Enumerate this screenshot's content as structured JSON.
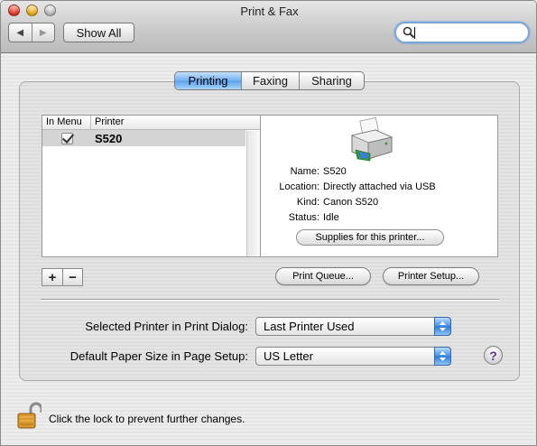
{
  "window": {
    "title": "Print & Fax"
  },
  "toolbar": {
    "back_label": "◀",
    "forward_label": "▶",
    "show_all_label": "Show All",
    "search_placeholder": "",
    "search_value": ""
  },
  "tabs": [
    {
      "label": "Printing",
      "active": true
    },
    {
      "label": "Faxing",
      "active": false
    },
    {
      "label": "Sharing",
      "active": false
    }
  ],
  "printer_list": {
    "columns": [
      "In Menu",
      "Printer"
    ],
    "rows": [
      {
        "in_menu": true,
        "name": "S520",
        "selected": true
      }
    ]
  },
  "printer_details": {
    "icon": "printer-icon",
    "fields": [
      {
        "label": "Name:",
        "value": "S520"
      },
      {
        "label": "Location:",
        "value": "Directly attached via USB"
      },
      {
        "label": "Kind:",
        "value": "Canon S520"
      },
      {
        "label": "Status:",
        "value": "Idle"
      }
    ],
    "supplies_label": "Supplies for this printer..."
  },
  "list_controls": {
    "add_label": "+",
    "remove_label": "−"
  },
  "buttons": {
    "print_queue": "Print Queue...",
    "printer_setup": "Printer Setup..."
  },
  "settings": {
    "selected_printer_label": "Selected Printer in Print Dialog:",
    "selected_printer_value": "Last Printer Used",
    "paper_size_label": "Default Paper Size in Page Setup:",
    "paper_size_value": "US Letter",
    "help_label": "?"
  },
  "lock": {
    "icon": "lock-open-icon",
    "text": "Click the lock to prevent further changes."
  },
  "colors": {
    "accent": "#5aa0ea",
    "popup_arrow": "#2c79dc",
    "help": "#5a2f9c",
    "lock": "#c98a2a"
  }
}
